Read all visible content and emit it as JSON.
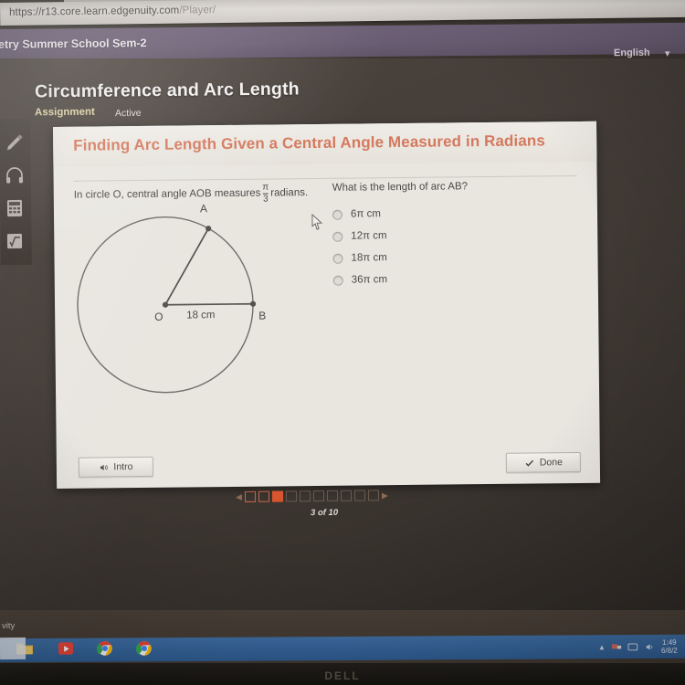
{
  "browser": {
    "url": "https://r13.core.learn.edgenuity.com/Player/",
    "url_scheme_host": "https://r13.core.learn.edgenuity.com",
    "url_path": "/Player/"
  },
  "appbar": {
    "course_name": "etry Summer School Sem-2",
    "language_label": "English",
    "language_caret": "chevron-down-icon"
  },
  "lesson": {
    "title": "Circumference and Arc Length",
    "assignment_label": "Assignment",
    "status_label": "Active"
  },
  "toolrail": {
    "items": [
      {
        "icon": "highlighter-icon",
        "label": "Highlighter"
      },
      {
        "icon": "headphones-icon",
        "label": "Audio"
      },
      {
        "icon": "calculator-icon",
        "label": "Calculator"
      },
      {
        "icon": "math-formula-icon",
        "label": "Formula"
      }
    ]
  },
  "card": {
    "heading": "Finding Arc Length Given a Central Angle Measured in Radians",
    "question_prefix": "In circle O, central angle AOB measures",
    "fraction_numerator": "π",
    "fraction_denominator": "3",
    "question_suffix": "radians.",
    "prompt": "What is the length of arc AB?",
    "choices": [
      {
        "label": "6π cm",
        "selected": false
      },
      {
        "label": "12π cm",
        "selected": false
      },
      {
        "label": "18π cm",
        "selected": false
      },
      {
        "label": "36π cm",
        "selected": false
      }
    ],
    "intro_button": "Intro",
    "done_button": "Done"
  },
  "diagram": {
    "center_label": "O",
    "point_a_label": "A",
    "point_b_label": "B",
    "radius_label": "18 cm",
    "radius_value": 18,
    "radius_units": "cm",
    "central_angle_radians": "π/3"
  },
  "pagination": {
    "prev_icon": "triangle-left-icon",
    "next_icon": "triangle-right-icon",
    "current": 3,
    "total": 10,
    "label": "3 of 10",
    "accent_color": "#d9552f"
  },
  "taskbar": {
    "desktop_text": "vity",
    "items": [
      {
        "icon": "file-explorer-icon",
        "label": "File Explorer"
      },
      {
        "icon": "media-player-icon",
        "label": "Media Player"
      },
      {
        "icon": "chrome-icon",
        "label": "Google Chrome"
      },
      {
        "icon": "chrome-icon",
        "label": "Google Chrome"
      }
    ],
    "tray": {
      "show_hidden_icon": "chevron-up-icon",
      "network_icon": "network-icon",
      "action_center_icon": "action-center-icon",
      "volume_icon": "speaker-icon",
      "time": "1:49",
      "date": "6/8/2"
    }
  },
  "monitor": {
    "brand": "DELL"
  },
  "colors": {
    "appbar_purple": "#6a5d73",
    "card_bg": "#e9e6e0",
    "heading_salmon": "#d4795e",
    "assignment_yellow": "#ded5a6",
    "taskbar_blue": "#2f5d93"
  }
}
